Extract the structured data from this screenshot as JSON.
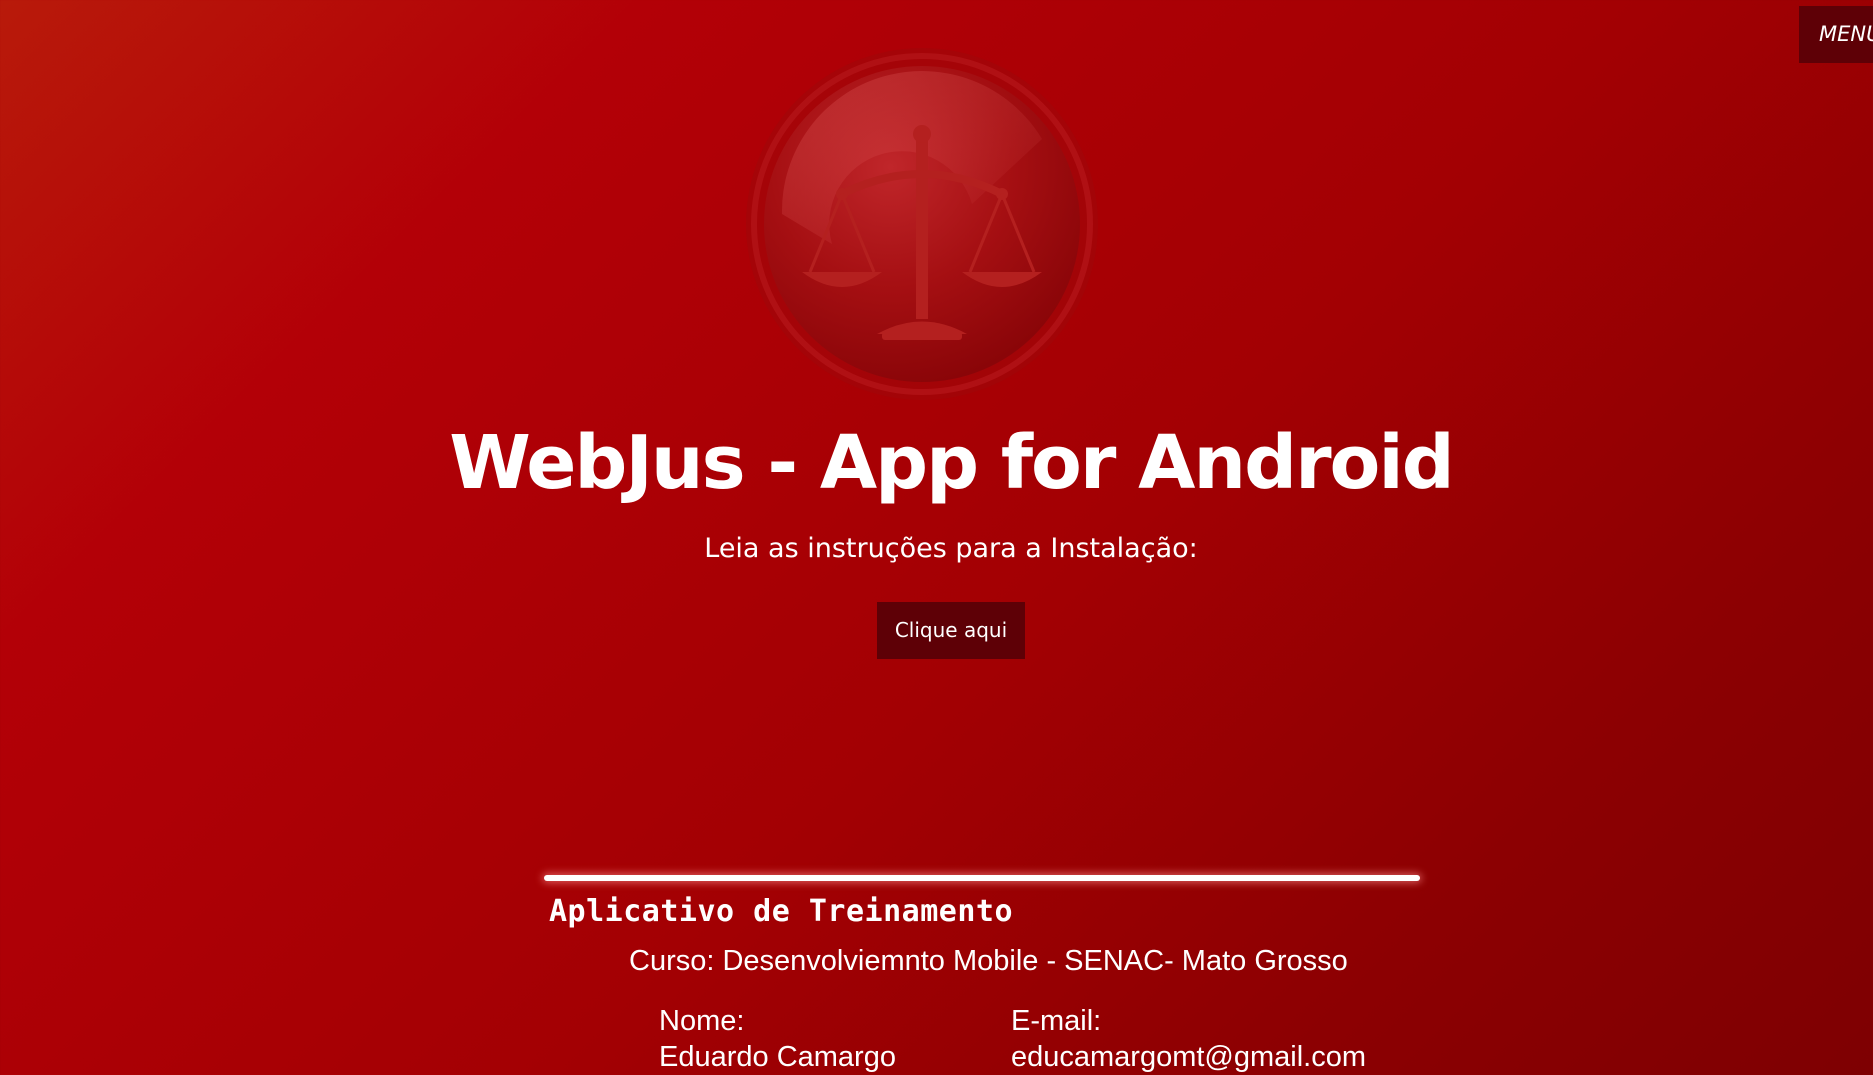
{
  "nav": {
    "menu_label": "MENU"
  },
  "hero": {
    "logo_icon": "scales-of-justice-icon",
    "title": "WebJus - App for Android",
    "subtitle": "Leia as instruções para a Instalação:",
    "cta_label": "Clique aqui"
  },
  "footer": {
    "title": "Aplicativo de Treinamento",
    "course": "Curso: Desenvolviemnto Mobile - SENAC- Mato Grosso",
    "name_label": "Nome:",
    "name_value": "Eduardo Camargo",
    "email_label": "E-mail:",
    "email_value": "educamargomt@gmail.com"
  },
  "colors": {
    "background_start": "#b81a0a",
    "background_end": "#7e0002",
    "button_bg": "#5e0006",
    "text": "#ffffff"
  }
}
